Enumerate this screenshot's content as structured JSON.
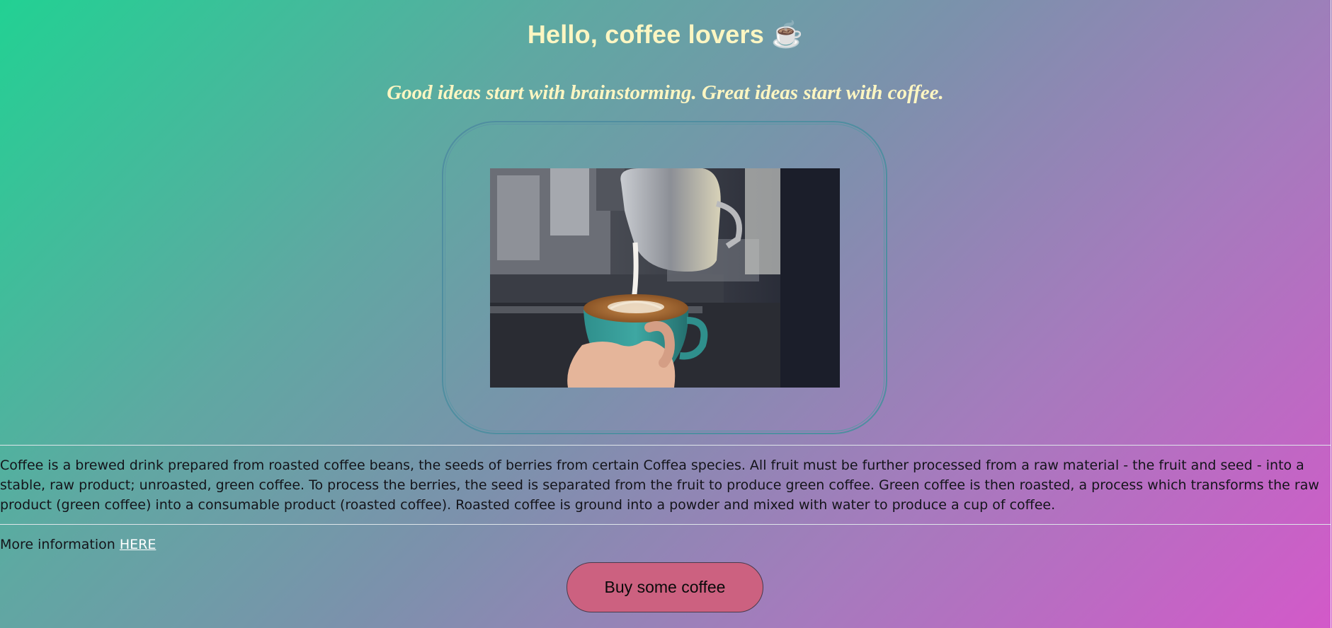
{
  "heading": {
    "text": "Hello, coffee lovers",
    "emoji": "☕"
  },
  "tagline": "Good ideas start with brainstorming. Great ideas start with coffee.",
  "image": {
    "alt": "Barista pouring latte art into a teal cup"
  },
  "description": "Coffee is a brewed drink prepared from roasted coffee beans, the seeds of berries from certain Coffea species. All fruit must be further processed from a raw material - the fruit and seed - into a stable, raw product; unroasted, green coffee. To process the berries, the seed is separated from the fruit to produce green coffee. Green coffee is then roasted, a process which transforms the raw product (green coffee) into a consumable product (roasted coffee). Roasted coffee is ground into a powder and mixed with water to produce a cup of coffee.",
  "more_info": {
    "prefix": "More information",
    "link_text": "HERE"
  },
  "buy_button": "Buy some coffee",
  "colors": {
    "heading": "#fdf6c2",
    "button": "#cc6180",
    "link": "#ffffff"
  }
}
